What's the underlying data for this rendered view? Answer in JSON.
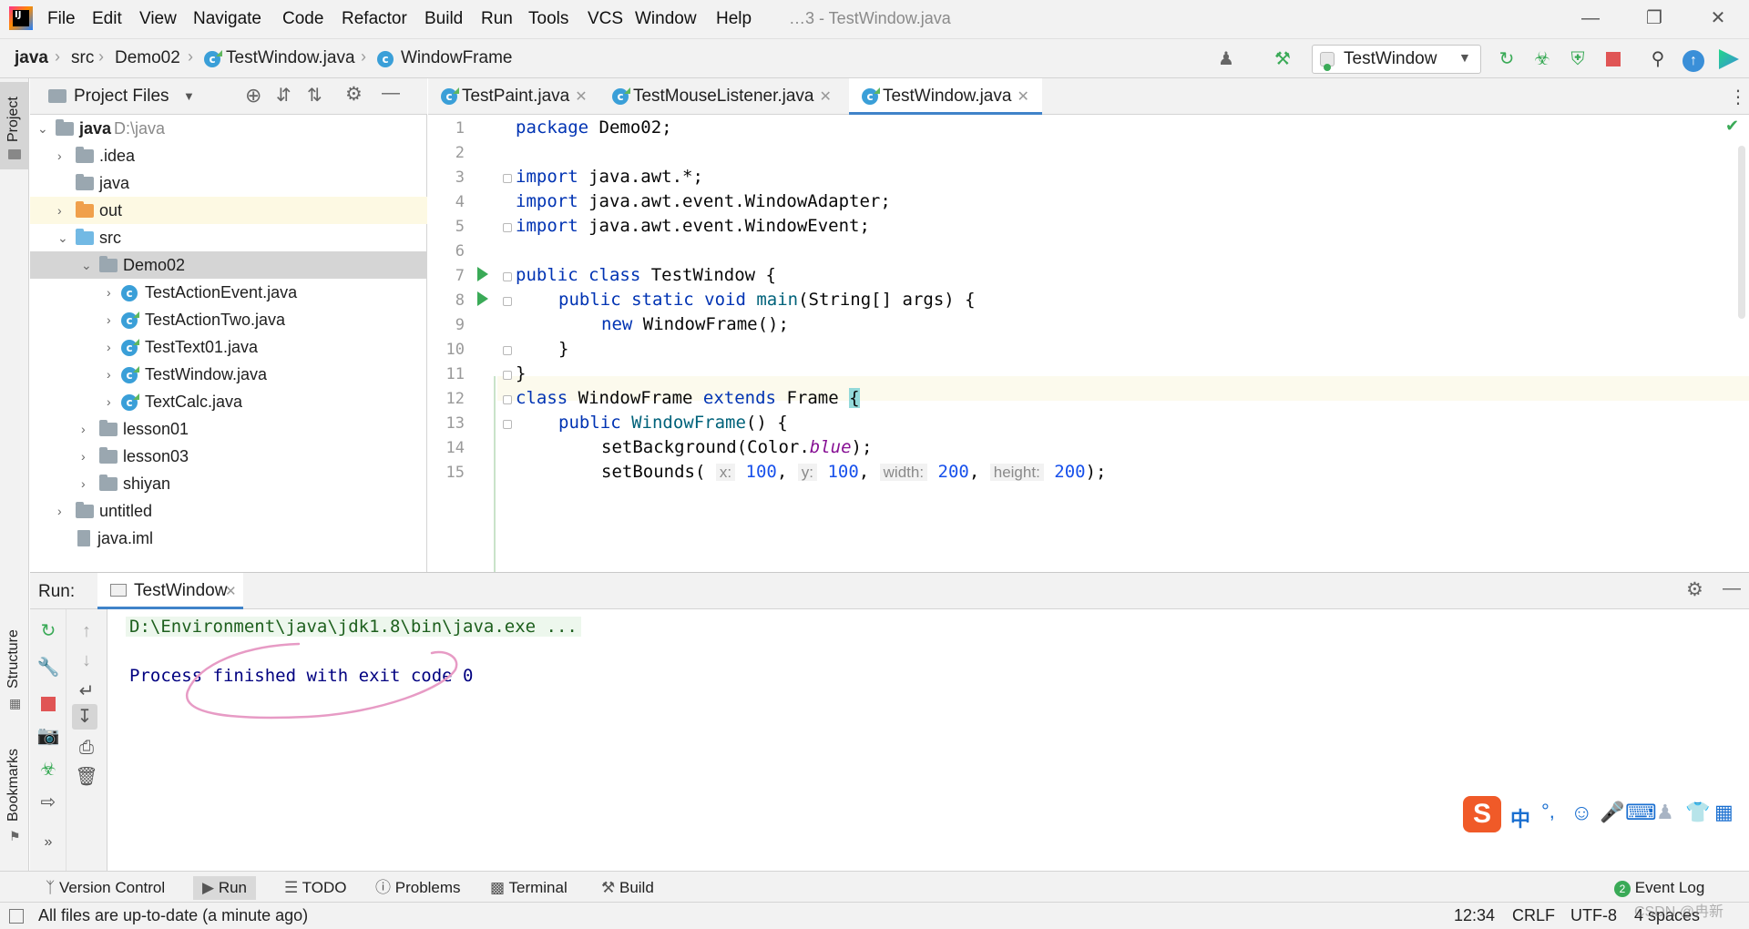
{
  "menu": {
    "items": [
      "File",
      "Edit",
      "View",
      "Navigate",
      "Code",
      "Refactor",
      "Build",
      "Run",
      "Tools",
      "VCS",
      "Window",
      "Help"
    ],
    "title": "…3 - TestWindow.java"
  },
  "navbar": {
    "crumbs": [
      "java",
      "src",
      "Demo02",
      "TestWindow.java",
      "WindowFrame"
    ],
    "run_config": "TestWindow"
  },
  "left_stripe": {
    "project": "Project",
    "structure": "Structure",
    "bookmarks": "Bookmarks"
  },
  "project": {
    "header": "Project Files",
    "tree": [
      {
        "label": "java",
        "extra": "D:\\java",
        "bold": true
      },
      {
        "label": ".idea"
      },
      {
        "label": "java"
      },
      {
        "label": "out"
      },
      {
        "label": "src"
      },
      {
        "label": "Demo02"
      },
      {
        "label": "TestActionEvent.java"
      },
      {
        "label": "TestActionTwo.java"
      },
      {
        "label": "TestText01.java"
      },
      {
        "label": "TestWindow.java"
      },
      {
        "label": "TextCalc.java"
      },
      {
        "label": "lesson01"
      },
      {
        "label": "lesson03"
      },
      {
        "label": "shiyan"
      },
      {
        "label": "untitled"
      },
      {
        "label": "java.iml"
      }
    ]
  },
  "editor": {
    "tabs": [
      "TestPaint.java",
      "TestMouseListener.java",
      "TestWindow.java"
    ],
    "active_tab": "TestWindow.java",
    "line_numbers": [
      "1",
      "2",
      "3",
      "4",
      "5",
      "6",
      "7",
      "8",
      "9",
      "10",
      "11",
      "12",
      "13",
      "14",
      "15"
    ],
    "code": {
      "l1_kw": "package",
      "l1_rest": " Demo02;",
      "l3_kw": "import",
      "l3_rest": " java.awt.*;",
      "l4_kw": "import",
      "l4_rest": " java.awt.event.WindowAdapter;",
      "l5_kw": "import",
      "l5_rest": " java.awt.event.WindowEvent;",
      "l7_kw": "public class",
      "l7_rest": " TestWindow {",
      "l8_kw": "public static void",
      "l8_fn": " main",
      "l8_rest": "(String[] args) {",
      "l9_kw": "new",
      "l9_rest": " WindowFrame();",
      "l10": "}",
      "l11": "}",
      "l12_kw1": "class",
      "l12_mid": " WindowFrame ",
      "l12_kw2": "extends",
      "l12_rest": " Frame ",
      "l12_brace": "{",
      "l13_kw": "public",
      "l13_fn": " WindowFrame",
      "l13_rest": "() {",
      "l14_a": "setBackground(Color.",
      "l14_it": "blue",
      "l14_b": ");",
      "l15_a": "setBounds(",
      "l15_hx": "x:",
      "l15_vx": "100",
      "l15_hy": "y:",
      "l15_vy": "100",
      "l15_hw": "width:",
      "l15_vw": "200",
      "l15_hh": "height:",
      "l15_vh": "200",
      "l15_end": ");"
    }
  },
  "run": {
    "label": "Run:",
    "tab": "TestWindow",
    "console": {
      "cmd": "D:\\Environment\\java\\jdk1.8\\bin\\java.exe ...",
      "result": "Process finished with exit code 0"
    }
  },
  "bottom_tools": [
    "Version Control",
    "Run",
    "TODO",
    "Problems",
    "Terminal",
    "Build"
  ],
  "event_log": {
    "count": "2",
    "label": "Event Log"
  },
  "status": {
    "message": "All files are up-to-date (a minute ago)",
    "position": "12:34",
    "line_sep": "CRLF",
    "encoding": "UTF-8",
    "indent": "4 spaces",
    "watermark": "CSDN @冉新"
  },
  "ime": {
    "logo": "S",
    "lang": "中",
    "punct": "°,"
  },
  "colors": {
    "accent": "#4083c9",
    "keyword": "#0033b3",
    "number": "#1750eb",
    "run_green": "#3aaa57",
    "stop_red": "#e05555",
    "annotation": "#e79bc5"
  }
}
